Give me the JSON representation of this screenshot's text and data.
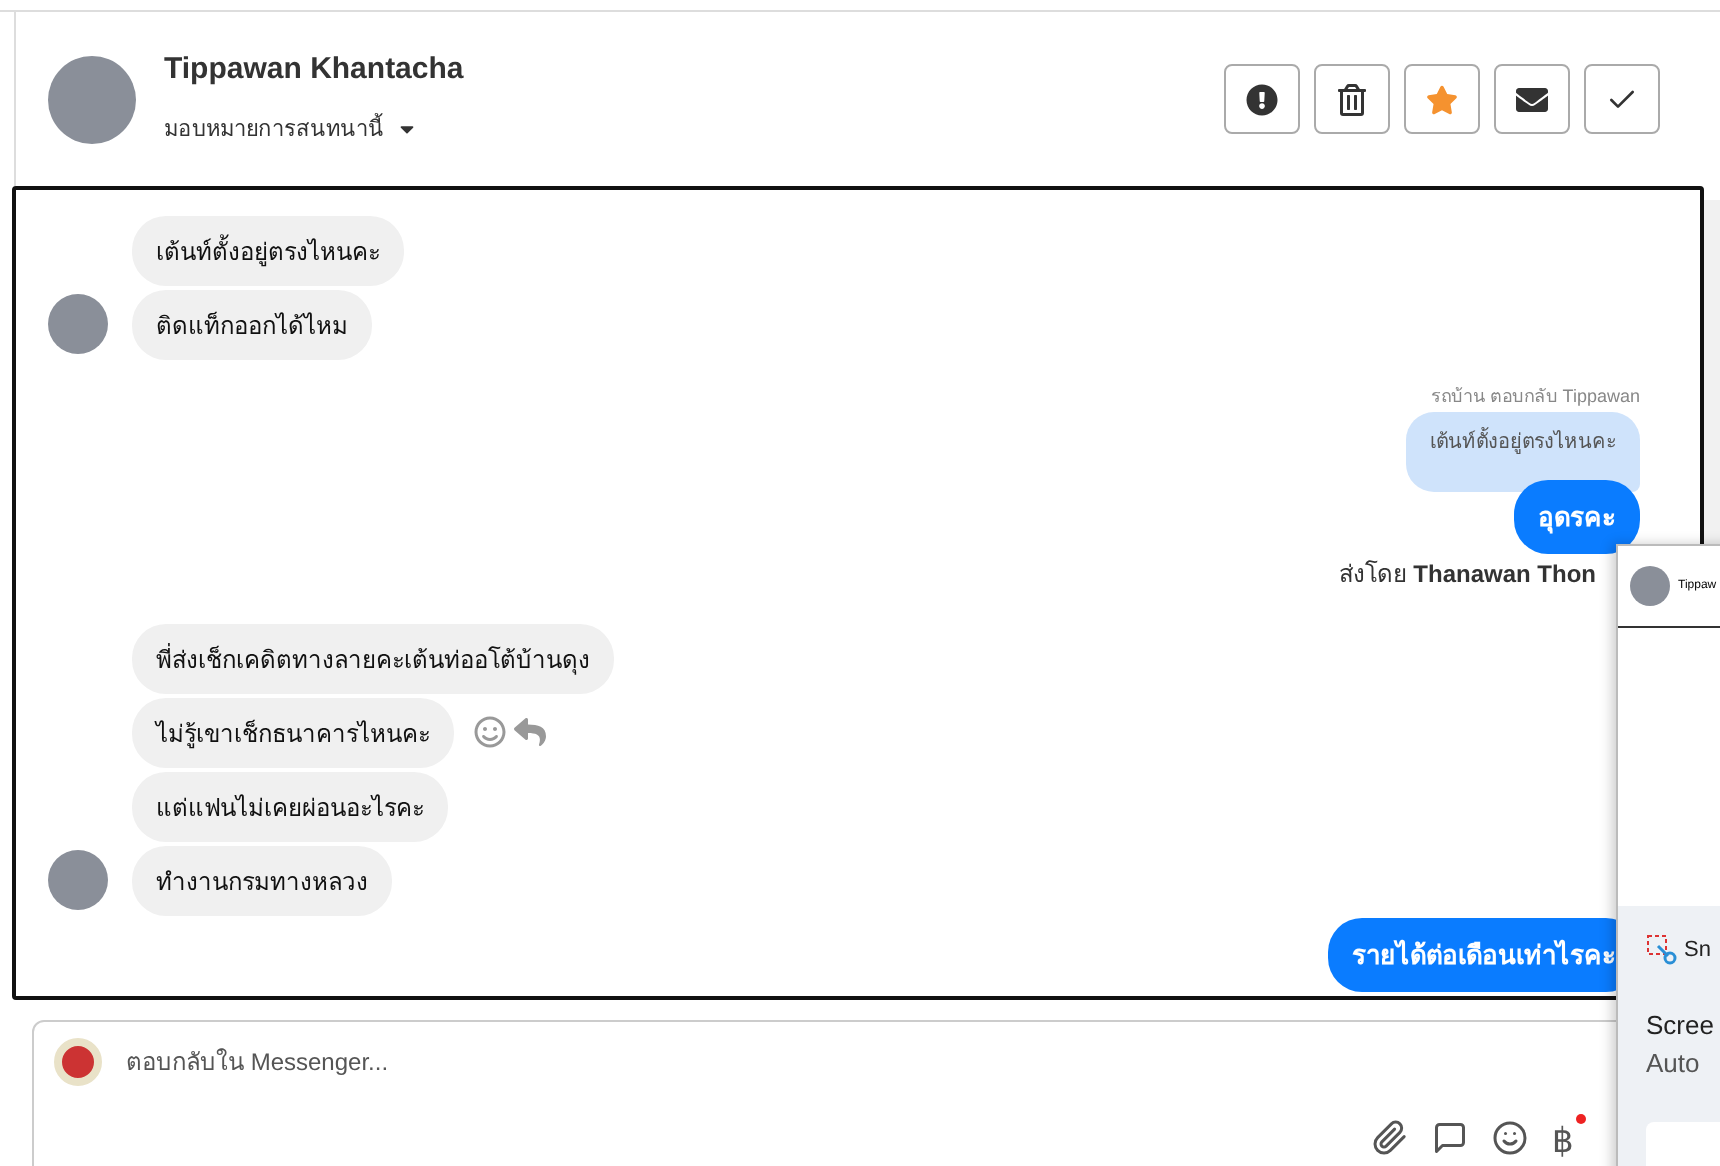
{
  "header": {
    "name": "Tippawan Khantacha",
    "assign_label": "มอบหมายการสนทนานี้",
    "actions": [
      {
        "kind": "alert"
      },
      {
        "kind": "delete"
      },
      {
        "kind": "star",
        "on": true
      },
      {
        "kind": "mail"
      },
      {
        "kind": "done"
      }
    ]
  },
  "messages": [
    {
      "kind": "in",
      "text": "เต้นท์ตั้งอยู่ตรงไหนคะ",
      "avatar": false
    },
    {
      "kind": "in",
      "text": "ติดแท็กออกได้ไหม",
      "avatar": true
    },
    {
      "kind": "reply_note",
      "text": "รถบ้าน ตอบกลับ Tippawan"
    },
    {
      "kind": "quote",
      "text": "เต้นท์ตั้งอยู่ตรงไหนคะ"
    },
    {
      "kind": "out",
      "text": "อุดรคะ"
    },
    {
      "kind": "sent_by",
      "prefix": "ส่งโดย",
      "name": "Thanawan Thon"
    },
    {
      "kind": "in",
      "text": "พี่ส่งเช็กเคดิตทางลายคะเต้นท่ออโต้บ้านดุง",
      "avatar": false
    },
    {
      "kind": "in",
      "text": "ไม่รู้เขาเช็กธนาคารไหนคะ",
      "avatar": false,
      "hover_actions": true
    },
    {
      "kind": "in",
      "text": "แต่แฟนไม่เคยผ่อนอะไรคะ",
      "avatar": false
    },
    {
      "kind": "in",
      "text": "ทำงานกรมทางหลวง",
      "avatar": true
    },
    {
      "kind": "out",
      "text": "รายได้ต่อเดือนเท่าไรคะ"
    }
  ],
  "composer": {
    "placeholder": "ตอบกลับใน Messenger...",
    "currency": "฿"
  },
  "overlay": {
    "chat_name": "Tippaw",
    "app_name": "Sn",
    "title": "Scree",
    "subtitle": "Auto"
  }
}
